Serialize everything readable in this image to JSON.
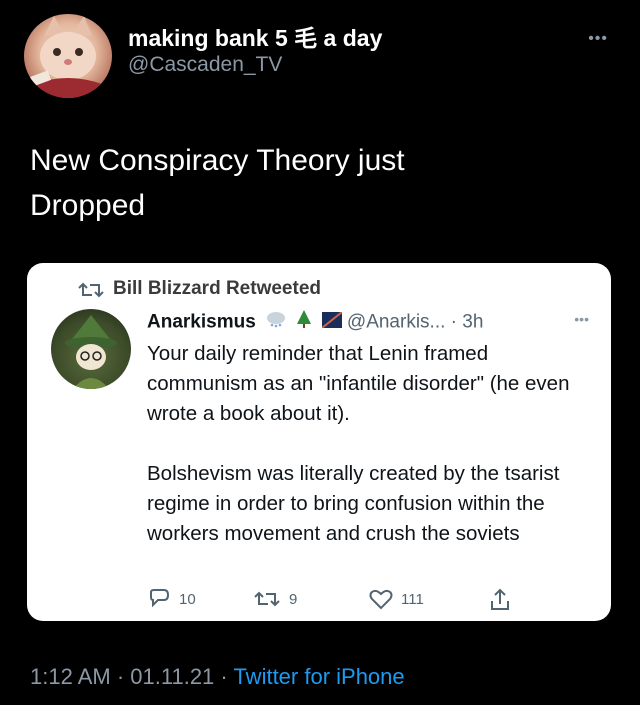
{
  "tweet": {
    "author": {
      "display_name": "making bank 5 毛 a day",
      "handle": "@Cascaden_TV",
      "avatar_icon": "cat-avatar"
    },
    "text_line1": "New Conspiracy Theory just",
    "text_line2": "Dropped",
    "more_icon": "more-options-icon",
    "footer": {
      "time": "1:12 AM",
      "separator1": " · ",
      "date": "01.11.21",
      "separator2": " · ",
      "source": "Twitter for iPhone"
    }
  },
  "embedded": {
    "retweeted_by": "Bill Blizzard Retweeted",
    "author": {
      "display_name": "Anarkismus",
      "handle": "@Anarkis...",
      "time": "· 3h",
      "emojis": [
        "snow-cloud-icon",
        "tree-icon",
        "flag-icon"
      ]
    },
    "paragraph1": "Your daily reminder that Lenin framed communism as an \"infantile disorder\" (he even wrote a book about it).",
    "paragraph2": "Bolshevism was literally created by the tsarist regime in order to bring confusion within the workers movement and crush the soviets",
    "actions": {
      "replies": "10",
      "retweets": "9",
      "likes": "111"
    }
  },
  "colors": {
    "background": "#000000",
    "card_background": "#ffffff",
    "link_blue": "#1d9bf0",
    "muted": "#8b98a5"
  }
}
